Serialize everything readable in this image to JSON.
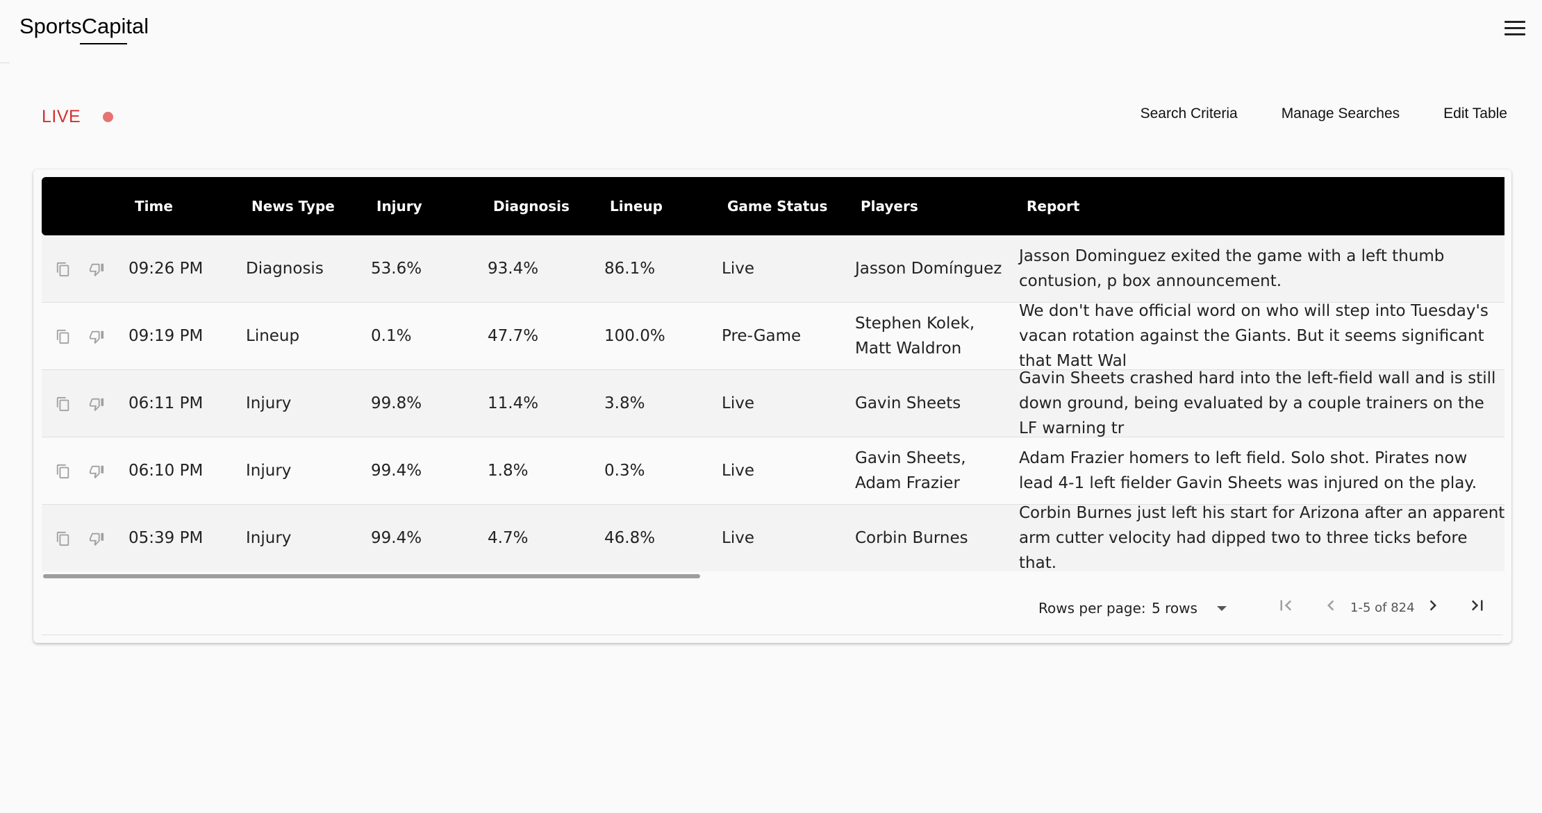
{
  "header": {
    "logo": "SportsCapital",
    "menu_icon": "hamburger-menu-icon"
  },
  "status": {
    "live_label": "LIVE",
    "live_dot_color": "#e57373"
  },
  "actions": {
    "search_criteria": "Search Criteria",
    "manage_searches": "Manage Searches",
    "edit_table": "Edit Table"
  },
  "table": {
    "columns": [
      "Time",
      "News Type",
      "Injury",
      "Diagnosis",
      "Lineup",
      "Game Status",
      "Players",
      "Report"
    ],
    "row_icons": [
      "copy-icon",
      "thumbs-down-icon"
    ],
    "rows": [
      {
        "time": "09:26 PM",
        "news_type": "Diagnosis",
        "injury": "53.6%",
        "diagnosis": "93.4%",
        "lineup": "86.1%",
        "game_status": "Live",
        "players": "Jasson Domínguez",
        "report": "Jasson Dominguez exited the game with a left thumb contusion, p box announcement."
      },
      {
        "time": "09:19 PM",
        "news_type": "Lineup",
        "injury": "0.1%",
        "diagnosis": "47.7%",
        "lineup": "100.0%",
        "game_status": "Pre-Game",
        "players": "Stephen Kolek, Matt Waldron",
        "report": "We don't have official word on who will step into Tuesday's vacan rotation against the Giants. But it seems significant that Matt Wal"
      },
      {
        "time": "06:11 PM",
        "news_type": "Injury",
        "injury": "99.8%",
        "diagnosis": "11.4%",
        "lineup": "3.8%",
        "game_status": "Live",
        "players": "Gavin Sheets",
        "report": "Gavin Sheets crashed hard into the left-field wall and is still down ground, being evaluated by a couple trainers on the LF warning tr"
      },
      {
        "time": "06:10 PM",
        "news_type": "Injury",
        "injury": "99.4%",
        "diagnosis": "1.8%",
        "lineup": "0.3%",
        "game_status": "Live",
        "players": "Gavin Sheets, Adam Frazier",
        "report": "Adam Frazier homers to left field. Solo shot. Pirates now lead 4-1 left fielder Gavin Sheets was injured on the play."
      },
      {
        "time": "05:39 PM",
        "news_type": "Injury",
        "injury": "99.4%",
        "diagnosis": "4.7%",
        "lineup": "46.8%",
        "game_status": "Live",
        "players": "Corbin Burnes",
        "report": "Corbin Burnes just left his start for Arizona after an apparent arm cutter velocity had dipped two to three ticks before that."
      }
    ]
  },
  "pagination": {
    "rows_per_page_label": "Rows per page:",
    "rows_per_page_value": "5 rows",
    "range": "1-5 of 824",
    "icons": [
      "first-page-icon",
      "prev-page-icon",
      "next-page-icon",
      "last-page-icon"
    ]
  }
}
